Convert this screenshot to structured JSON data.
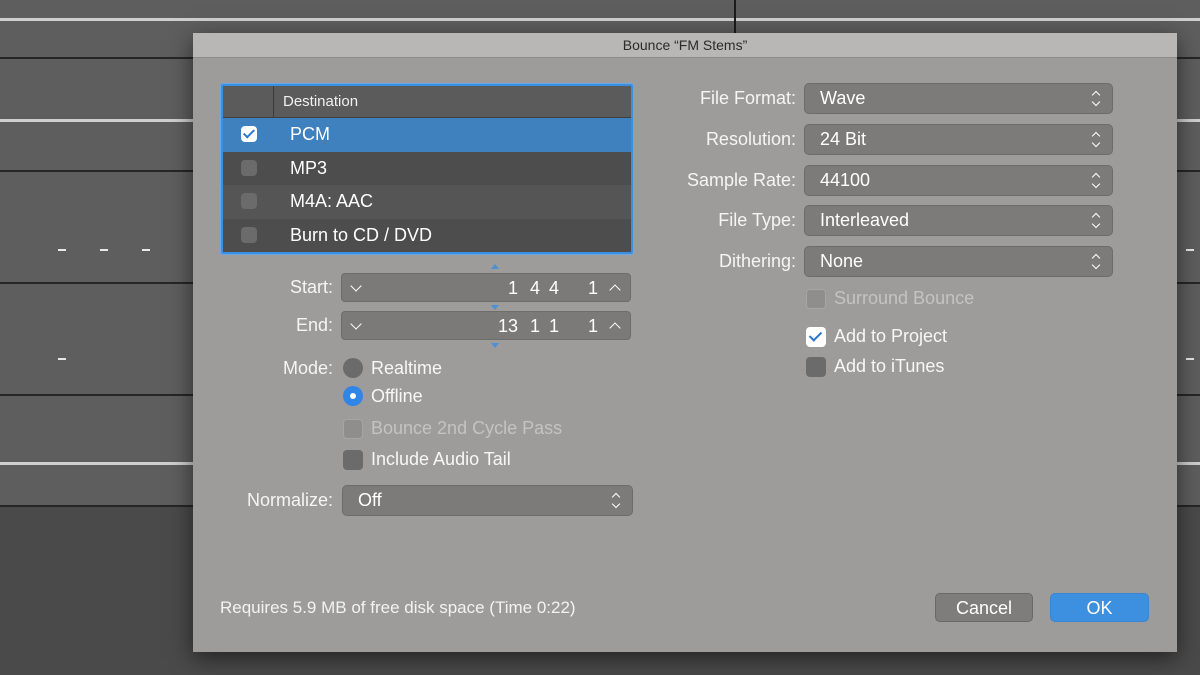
{
  "dialog": {
    "title": "Bounce “FM Stems”"
  },
  "destination": {
    "header": "Destination",
    "rows": [
      {
        "label": "PCM",
        "checked": true,
        "selected": true
      },
      {
        "label": "MP3",
        "checked": false,
        "selected": false
      },
      {
        "label": "M4A: AAC",
        "checked": false,
        "selected": false
      },
      {
        "label": "Burn to CD / DVD",
        "checked": false,
        "selected": false
      }
    ]
  },
  "range": {
    "start_label": "Start:",
    "start": {
      "bar": "1",
      "beat": "4",
      "division": "4",
      "tick": "1"
    },
    "end_label": "End:",
    "end": {
      "bar": "13",
      "beat": "1",
      "division": "1",
      "tick": "1"
    }
  },
  "mode": {
    "label": "Mode:",
    "options": [
      "Realtime",
      "Offline"
    ],
    "selected": "Offline"
  },
  "options": {
    "bounce_2nd_cycle": {
      "label": "Bounce 2nd Cycle Pass",
      "checked": false,
      "enabled": false
    },
    "include_audio_tail": {
      "label": "Include Audio Tail",
      "checked": false,
      "enabled": true
    }
  },
  "normalize": {
    "label": "Normalize:",
    "value": "Off"
  },
  "format": {
    "file_format": {
      "label": "File Format:",
      "value": "Wave"
    },
    "resolution": {
      "label": "Resolution:",
      "value": "24 Bit"
    },
    "sample_rate": {
      "label": "Sample Rate:",
      "value": "44100"
    },
    "file_type": {
      "label": "File Type:",
      "value": "Interleaved"
    },
    "dithering": {
      "label": "Dithering:",
      "value": "None"
    }
  },
  "checks": {
    "surround_bounce": {
      "label": "Surround Bounce",
      "checked": false,
      "enabled": false
    },
    "add_to_project": {
      "label": "Add to Project",
      "checked": true,
      "enabled": true
    },
    "add_to_itunes": {
      "label": "Add to iTunes",
      "checked": false,
      "enabled": true
    }
  },
  "footer": {
    "disk_space": "Requires 5.9 MB of free disk space  (Time 0:22)",
    "cancel_label": "Cancel",
    "ok_label": "OK"
  },
  "colors": {
    "accent": "#3d8fe0",
    "dialog_bg": "#9d9c9b",
    "selected_row": "#3f80bf"
  },
  "icons": [
    "checkmark-icon",
    "chevron-down-icon",
    "chevron-up-icon",
    "up-down-arrows-icon",
    "radio-dot-icon"
  ]
}
